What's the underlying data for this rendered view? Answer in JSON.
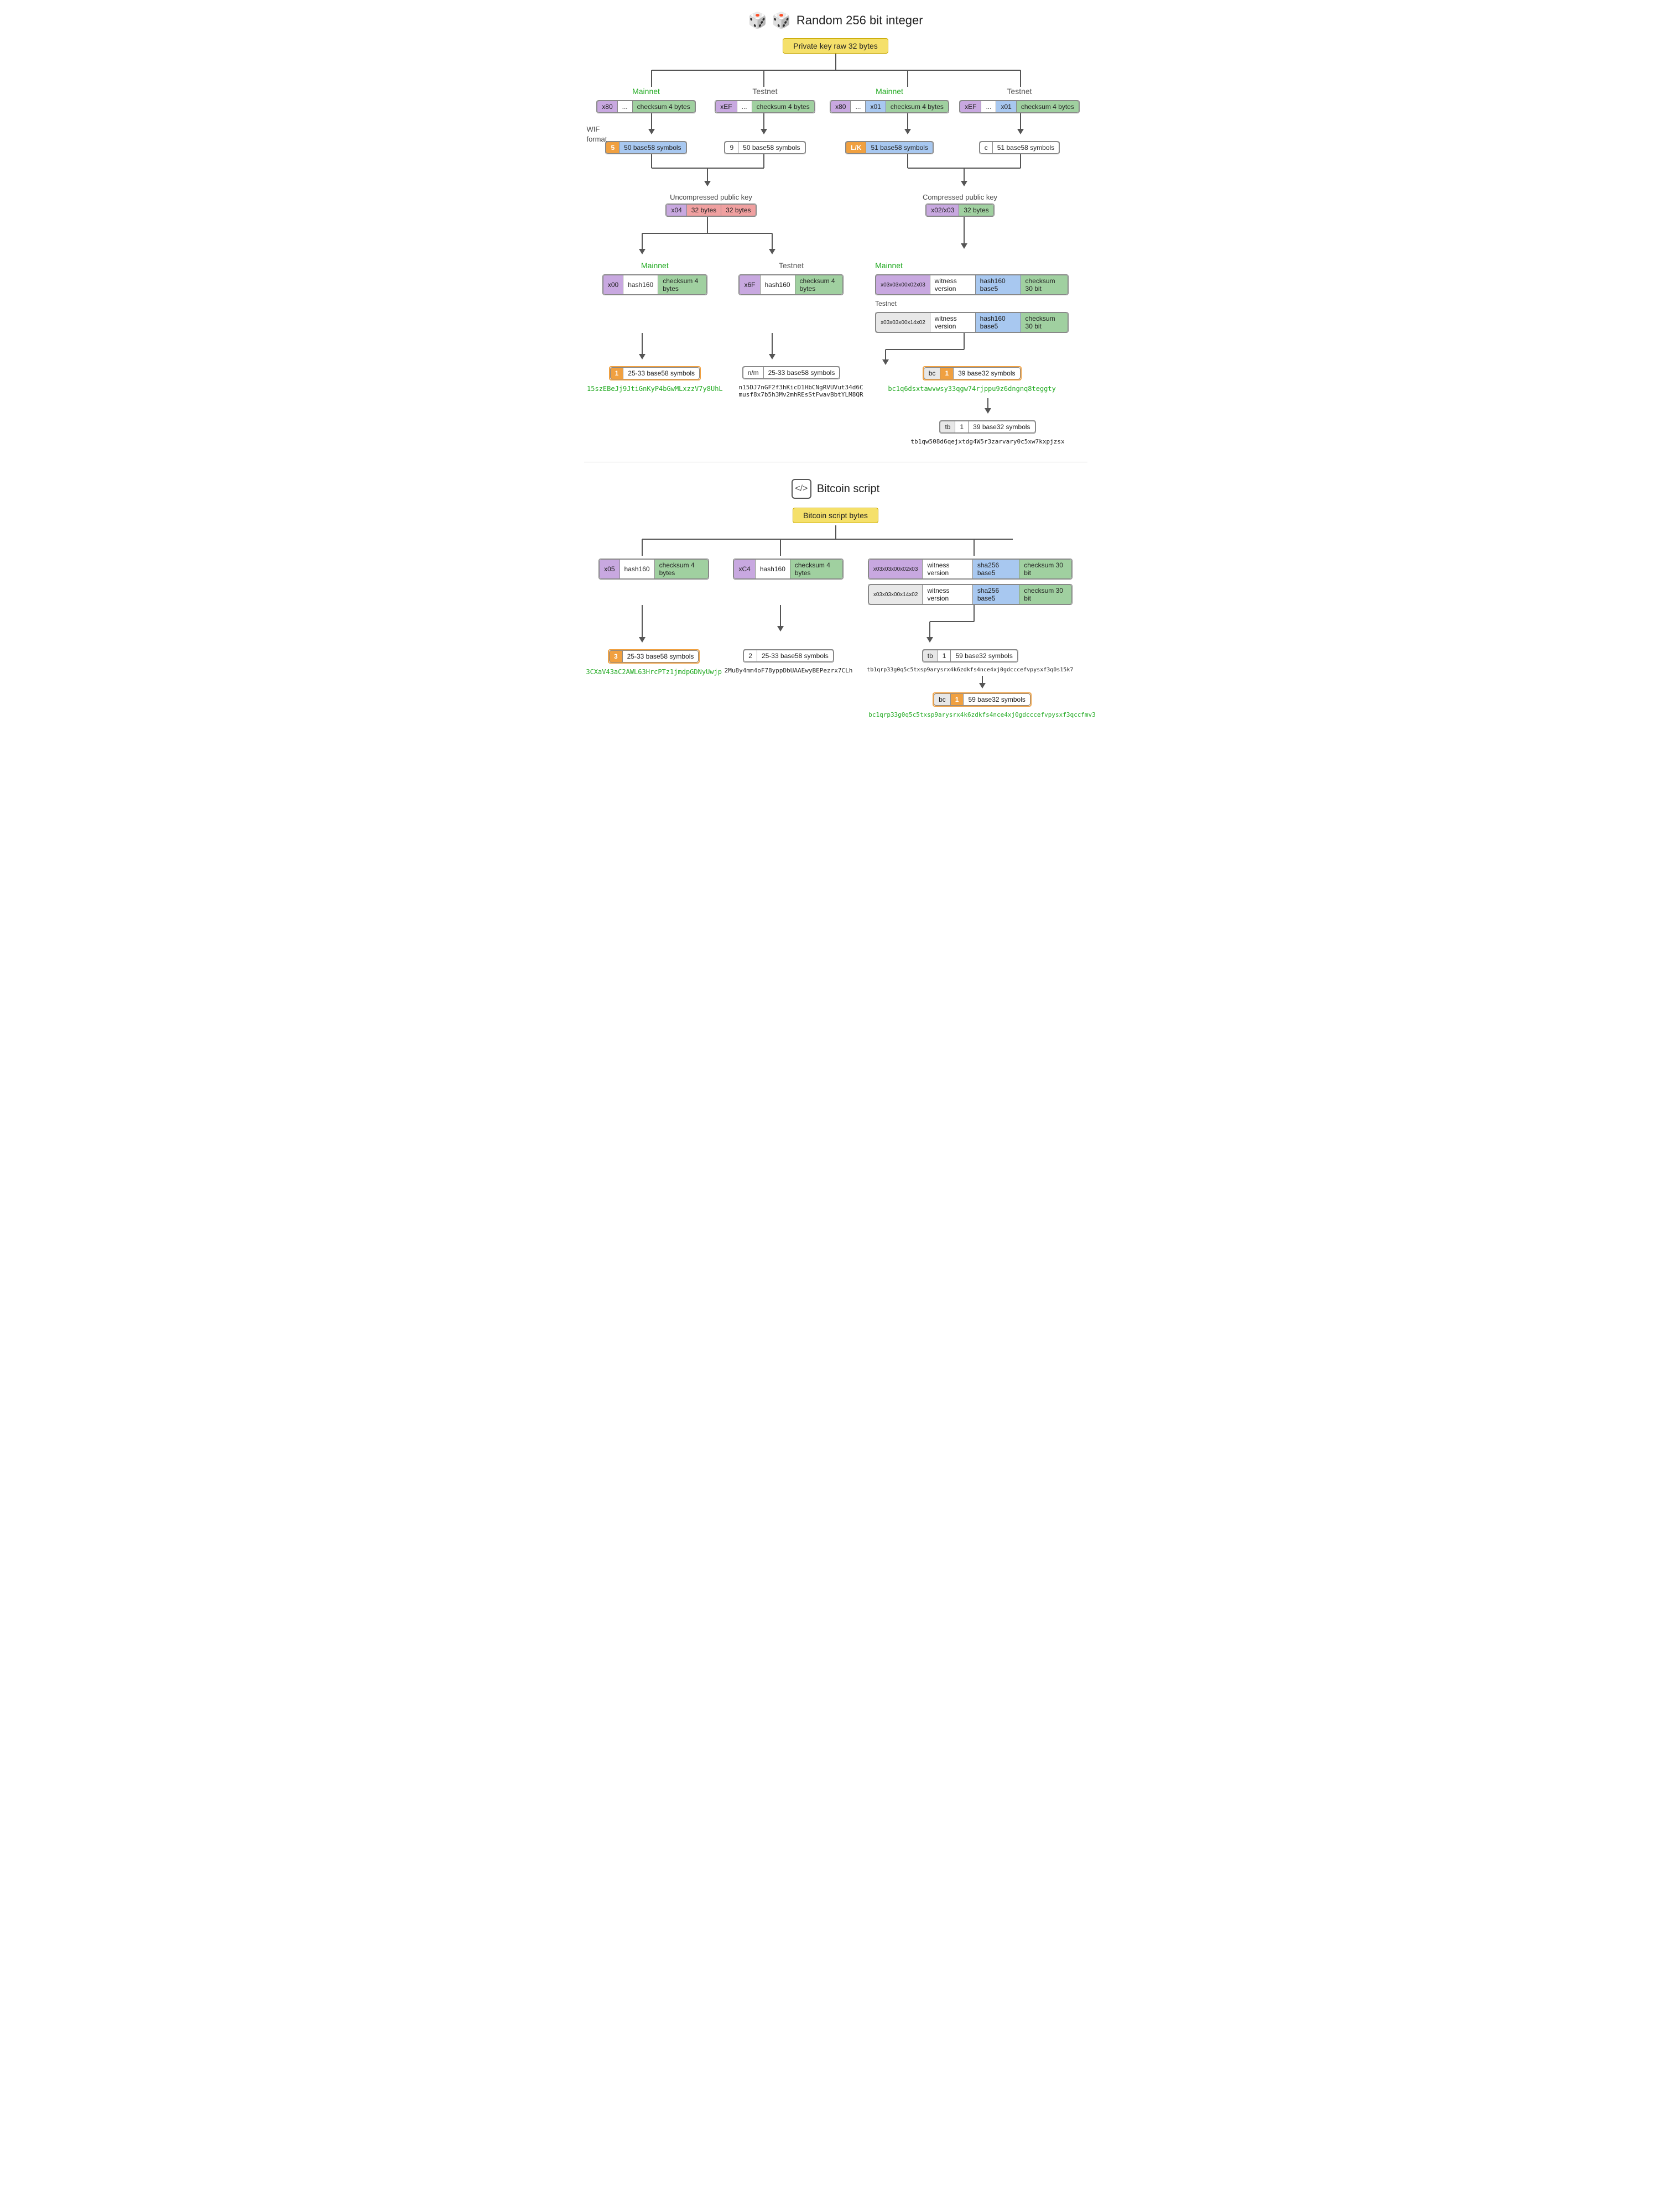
{
  "page": {
    "title": "Random 256 bit integer",
    "section2_title": "Bitcoin script"
  },
  "top_section": {
    "root_label": "Private key raw 32 bytes",
    "columns": [
      {
        "network_label": "Mainnet",
        "network_color": "mainnet",
        "bytes_row": [
          "x80",
          "...",
          "checksum 4 bytes"
        ],
        "wif_prefix": "5",
        "wif_symbols": "50 base58 symbols"
      },
      {
        "network_label": "Testnet",
        "network_color": "testnet",
        "bytes_row": [
          "xEF",
          "...",
          "checksum 4 bytes"
        ],
        "wif_prefix": "9",
        "wif_symbols": "50 base58 symbols"
      },
      {
        "network_label": "Mainnet",
        "network_color": "mainnet",
        "bytes_row": [
          "x80",
          "...",
          "x01",
          "checksum 4 bytes"
        ],
        "wif_prefix": "L/K",
        "wif_symbols": "51 base58 symbols"
      },
      {
        "network_label": "Testnet",
        "network_color": "testnet",
        "bytes_row": [
          "xEF",
          "...",
          "x01",
          "checksum 4 bytes"
        ],
        "wif_prefix": "c",
        "wif_symbols": "51 base58 symbols"
      }
    ],
    "wif_label": "WIF\nformat",
    "uncompressed_pubkey": {
      "label": "Uncompressed public key",
      "bytes": [
        "x04",
        "32 bytes",
        "32 bytes"
      ]
    },
    "compressed_pubkey": {
      "label": "Compressed public key",
      "bytes": [
        "x02/x03",
        "32 bytes"
      ]
    },
    "p2pkh_mainnet": {
      "label": "Mainnet",
      "bytes_row": [
        "x00",
        "hash160",
        "checksum 4 bytes"
      ],
      "prefix": "1",
      "symbols": "25-33 base58 symbols",
      "example": "15szEBeJj9JtiGnKyP4bGwMLxzzV7y8UhL"
    },
    "p2pkh_testnet": {
      "label": "Testnet",
      "bytes_row": [
        "x6F",
        "hash160",
        "checksum 4 bytes"
      ],
      "prefix": "n/m",
      "symbols": "25-33 base58 symbols",
      "example": "n15DJ7nGF2f3hKicD1HbCNgRVUVut34d6C\nmusf8x7b5h3Mv2mhREsStFwavBbtYLM8QR"
    },
    "p2wpkh_mainnet": {
      "label": "Mainnet",
      "bytes_row": [
        "x03x03x00x02x03",
        "witness version",
        "hash160 base5",
        "checksum 30 bit"
      ],
      "prefix_bc": "bc",
      "prefix_1": "1",
      "symbols": "39 base32 symbols",
      "example": "bc1q6dsxtawvwsy33qgw74rjppu9z6dngnq8teggty"
    },
    "p2wpkh_testnet": {
      "label": "Testnet",
      "bytes_row": [
        "x03x03x00x14x02",
        "witness version",
        "hash160 base5",
        "checksum 30 bit"
      ],
      "prefix_tb": "tb",
      "prefix_1": "1",
      "symbols": "39 base32 symbols",
      "example": "tb1qw508d6qejxtdg4W5r3zarvary0c5xw7kxpjzsx"
    }
  },
  "bottom_section": {
    "root_label": "Bitcoin script bytes",
    "p2sh_col1": {
      "bytes_row": [
        "x05",
        "hash160",
        "checksum 4 bytes"
      ],
      "prefix": "3",
      "symbols": "25-33 base58 symbols",
      "example": "3CXaV43aC2AWL63HrcPTz1jmdpGDNyUwjp"
    },
    "p2sh_col2": {
      "bytes_row": [
        "xC4",
        "hash160",
        "checksum 4 bytes"
      ],
      "prefix": "2",
      "symbols": "25-33 base58 symbols",
      "example": "2Mu8y4mm4oF78yppDbUAAEwyBEPezrx7CLh"
    },
    "p2wsh_mainnet": {
      "bytes_row": [
        "x03x03x00x02x03",
        "witness version",
        "sha256 base5",
        "checksum 30 bit"
      ],
      "prefix_bc": "bc",
      "prefix_1": "1",
      "symbols": "59 base32 symbols",
      "example": "bc1qrp33g0q5c5txsp9arysrx4k6zdkfs4nce4xj0gdcccefvpysxf3qccfmv3"
    },
    "p2wsh_testnet": {
      "bytes_row": [
        "x03x03x00x14x02",
        "witness version",
        "sha256 base5",
        "checksum 30 bit"
      ],
      "prefix_tb": "tb",
      "prefix_1": "1",
      "symbols": "59 base32 symbols",
      "example": "tb1qrp33g0q5c5txsp9arysrx4k6zdkfs4nce4xj0gdcccefvpysxf3q0s15k7"
    }
  }
}
